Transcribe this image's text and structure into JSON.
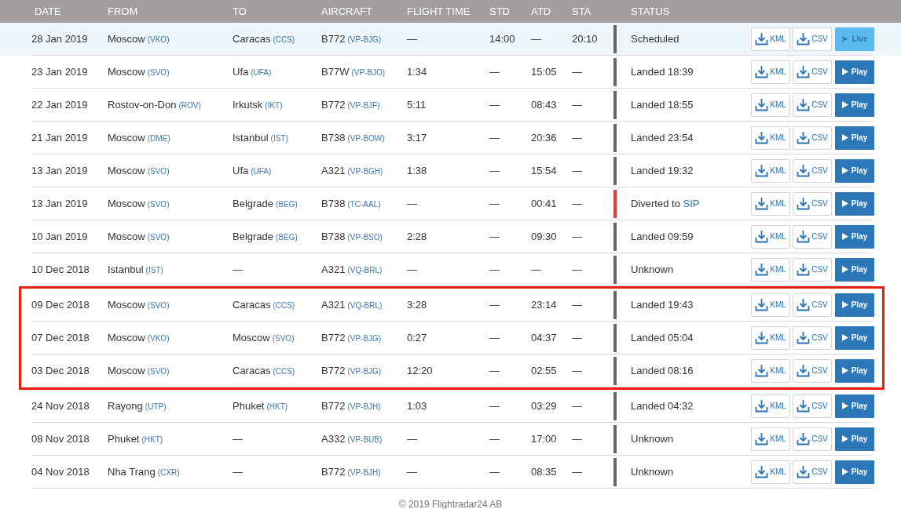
{
  "columns": [
    "DATE",
    "FROM",
    "TO",
    "AIRCRAFT",
    "FLIGHT TIME",
    "STD",
    "ATD",
    "STA",
    "STATUS"
  ],
  "rows": [
    {
      "date": "28 Jan 2019",
      "from": {
        "city": "Moscow",
        "code": "(VKO)"
      },
      "to": {
        "city": "Caracas",
        "code": "(CCS)"
      },
      "aircraft": {
        "type": "B772",
        "reg": "(VP-BJG)"
      },
      "flight_time": "—",
      "std": "14:00",
      "atd": "—",
      "sta": "20:10",
      "status": "Scheduled",
      "color": "#666666",
      "current": true,
      "highlighted": false,
      "kml": "KML",
      "csv": "CSV",
      "action": {
        "kind": "live",
        "label": "Live"
      }
    },
    {
      "date": "23 Jan 2019",
      "from": {
        "city": "Moscow",
        "code": "(SVO)"
      },
      "to": {
        "city": "Ufa",
        "code": "(UFA)"
      },
      "aircraft": {
        "type": "B77W",
        "reg": "(VP-BJO)"
      },
      "flight_time": "1:34",
      "std": "—",
      "atd": "15:05",
      "sta": "—",
      "status": "Landed 18:39",
      "color": "#666666",
      "current": false,
      "highlighted": false,
      "kml": "KML",
      "csv": "CSV",
      "action": {
        "kind": "play",
        "label": "Play"
      }
    },
    {
      "date": "22 Jan 2019",
      "from": {
        "city": "Rostov-on-Don",
        "code": "(ROV)"
      },
      "to": {
        "city": "Irkutsk",
        "code": "(IKT)"
      },
      "aircraft": {
        "type": "B772",
        "reg": "(VP-BJF)"
      },
      "flight_time": "5:11",
      "std": "—",
      "atd": "08:43",
      "sta": "—",
      "status": "Landed 18:55",
      "color": "#666666",
      "current": false,
      "highlighted": false,
      "kml": "KML",
      "csv": "CSV",
      "action": {
        "kind": "play",
        "label": "Play"
      }
    },
    {
      "date": "21 Jan 2019",
      "from": {
        "city": "Moscow",
        "code": "(DME)"
      },
      "to": {
        "city": "Istanbul",
        "code": "(IST)"
      },
      "aircraft": {
        "type": "B738",
        "reg": "(VP-BOW)"
      },
      "flight_time": "3:17",
      "std": "—",
      "atd": "20:36",
      "sta": "—",
      "status": "Landed 23:54",
      "color": "#666666",
      "current": false,
      "highlighted": false,
      "kml": "KML",
      "csv": "CSV",
      "action": {
        "kind": "play",
        "label": "Play"
      }
    },
    {
      "date": "13 Jan 2019",
      "from": {
        "city": "Moscow",
        "code": "(SVO)"
      },
      "to": {
        "city": "Ufa",
        "code": "(UFA)"
      },
      "aircraft": {
        "type": "A321",
        "reg": "(VP-BGH)"
      },
      "flight_time": "1:38",
      "std": "—",
      "atd": "15:54",
      "sta": "—",
      "status": "Landed 19:32",
      "color": "#666666",
      "current": false,
      "highlighted": false,
      "kml": "KML",
      "csv": "CSV",
      "action": {
        "kind": "play",
        "label": "Play"
      }
    },
    {
      "date": "13 Jan 2019",
      "from": {
        "city": "Moscow",
        "code": "(SVO)"
      },
      "to": {
        "city": "Belgrade",
        "code": "(BEG)"
      },
      "aircraft": {
        "type": "B738",
        "reg": "(TC-AAL)"
      },
      "flight_time": "—",
      "std": "—",
      "atd": "00:41",
      "sta": "—",
      "status": "Diverted to",
      "status_link": "SIP",
      "color": "#e8393c",
      "current": false,
      "highlighted": false,
      "kml": "KML",
      "csv": "CSV",
      "action": {
        "kind": "play",
        "label": "Play"
      }
    },
    {
      "date": "10 Jan 2019",
      "from": {
        "city": "Moscow",
        "code": "(SVO)"
      },
      "to": {
        "city": "Belgrade",
        "code": "(BEG)"
      },
      "aircraft": {
        "type": "B738",
        "reg": "(VP-BSO)"
      },
      "flight_time": "2:28",
      "std": "—",
      "atd": "09:30",
      "sta": "—",
      "status": "Landed 09:59",
      "color": "#666666",
      "current": false,
      "highlighted": false,
      "kml": "KML",
      "csv": "CSV",
      "action": {
        "kind": "play",
        "label": "Play"
      }
    },
    {
      "date": "10 Dec 2018",
      "from": {
        "city": "Istanbul",
        "code": "(IST)"
      },
      "to": {
        "city": "—"
      },
      "aircraft": {
        "type": "A321",
        "reg": "(VQ-BRL)"
      },
      "flight_time": "—",
      "std": "—",
      "atd": "—",
      "sta": "—",
      "status": "Unknown",
      "color": "#666666",
      "current": false,
      "highlighted": false,
      "kml": "KML",
      "csv": "CSV",
      "action": {
        "kind": "play",
        "label": "Play"
      }
    },
    {
      "date": "09 Dec 2018",
      "from": {
        "city": "Moscow",
        "code": "(SVO)"
      },
      "to": {
        "city": "Caracas",
        "code": "(CCS)"
      },
      "aircraft": {
        "type": "A321",
        "reg": "(VQ-BRL)"
      },
      "flight_time": "3:28",
      "std": "—",
      "atd": "23:14",
      "sta": "—",
      "status": "Landed 19:43",
      "color": "#666666",
      "current": false,
      "highlighted": true,
      "kml": "KML",
      "csv": "CSV",
      "action": {
        "kind": "play",
        "label": "Play"
      }
    },
    {
      "date": "07 Dec 2018",
      "from": {
        "city": "Moscow",
        "code": "(VKO)"
      },
      "to": {
        "city": "Moscow",
        "code": "(SVO)"
      },
      "aircraft": {
        "type": "B772",
        "reg": "(VP-BJG)"
      },
      "flight_time": "0:27",
      "std": "—",
      "atd": "04:37",
      "sta": "—",
      "status": "Landed 05:04",
      "color": "#666666",
      "current": false,
      "highlighted": true,
      "kml": "KML",
      "csv": "CSV",
      "action": {
        "kind": "play",
        "label": "Play"
      }
    },
    {
      "date": "03 Dec 2018",
      "from": {
        "city": "Moscow",
        "code": "(SVO)"
      },
      "to": {
        "city": "Caracas",
        "code": "(CCS)"
      },
      "aircraft": {
        "type": "B772",
        "reg": "(VP-BJG)"
      },
      "flight_time": "12:20",
      "std": "—",
      "atd": "02:55",
      "sta": "—",
      "status": "Landed 08:16",
      "color": "#666666",
      "current": false,
      "highlighted": true,
      "kml": "KML",
      "csv": "CSV",
      "action": {
        "kind": "play",
        "label": "Play"
      }
    },
    {
      "date": "24 Nov 2018",
      "from": {
        "city": "Rayong",
        "code": "(UTP)"
      },
      "to": {
        "city": "Phuket",
        "code": "(HKT)"
      },
      "aircraft": {
        "type": "B772",
        "reg": "(VP-BJH)"
      },
      "flight_time": "1:03",
      "std": "—",
      "atd": "03:29",
      "sta": "—",
      "status": "Landed 04:32",
      "color": "#666666",
      "current": false,
      "highlighted": false,
      "kml": "KML",
      "csv": "CSV",
      "action": {
        "kind": "play",
        "label": "Play"
      }
    },
    {
      "date": "08 Nov 2018",
      "from": {
        "city": "Phuket",
        "code": "(HKT)"
      },
      "to": {
        "city": "—"
      },
      "aircraft": {
        "type": "A332",
        "reg": "(VP-BUB)"
      },
      "flight_time": "—",
      "std": "—",
      "atd": "17:00",
      "sta": "—",
      "status": "Unknown",
      "color": "#666666",
      "current": false,
      "highlighted": false,
      "kml": "KML",
      "csv": "CSV",
      "action": {
        "kind": "play",
        "label": "Play"
      }
    },
    {
      "date": "04 Nov 2018",
      "from": {
        "city": "Nha Trang",
        "code": "(CXR)"
      },
      "to": {
        "city": "—"
      },
      "aircraft": {
        "type": "B772",
        "reg": "(VP-BJH)"
      },
      "flight_time": "—",
      "std": "—",
      "atd": "08:35",
      "sta": "—",
      "status": "Unknown",
      "color": "#666666",
      "current": false,
      "highlighted": false,
      "kml": "KML",
      "csv": "CSV",
      "action": {
        "kind": "play",
        "label": "Play"
      }
    }
  ],
  "footer": "© 2019 Flightradar24 AB"
}
